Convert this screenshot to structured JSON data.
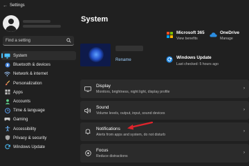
{
  "window": {
    "title": "Settings"
  },
  "search": {
    "placeholder": "Find a setting"
  },
  "sidebar": {
    "items": [
      {
        "label": "System",
        "icon": "monitor-icon",
        "color": "#4cc2ff",
        "active": true
      },
      {
        "label": "Bluetooth & devices",
        "icon": "bluetooth-icon",
        "color": "#4c9bff"
      },
      {
        "label": "Network & internet",
        "icon": "wifi-icon",
        "color": "#9ec9ff"
      },
      {
        "label": "Personalization",
        "icon": "brush-icon",
        "color": "#f0b35a"
      },
      {
        "label": "Apps",
        "icon": "apps-icon",
        "color": "#c9c9c9"
      },
      {
        "label": "Accounts",
        "icon": "person-icon",
        "color": "#5fd18b"
      },
      {
        "label": "Time & language",
        "icon": "globe-clock-icon",
        "color": "#5fa8ff"
      },
      {
        "label": "Gaming",
        "icon": "gamepad-icon",
        "color": "#c9c9c9"
      },
      {
        "label": "Accessibility",
        "icon": "accessibility-icon",
        "color": "#6fb8ff"
      },
      {
        "label": "Privacy & security",
        "icon": "shield-icon",
        "color": "#a7a7a7"
      },
      {
        "label": "Windows Update",
        "icon": "update-icon",
        "color": "#4cc2ff"
      }
    ]
  },
  "main": {
    "title": "System",
    "device": {
      "rename_label": "Rename"
    },
    "quick": [
      {
        "title": "Microsoft 365",
        "subtitle": "View benefits",
        "icon": "microsoft-icon"
      },
      {
        "title": "OneDrive",
        "subtitle": "Manage",
        "icon": "cloud-icon"
      },
      {
        "title": "Windows Update",
        "subtitle": "Last checked: 5 hours ago",
        "icon": "update-icon"
      }
    ],
    "cards": [
      {
        "title": "Display",
        "subtitle": "Monitors, brightness, night light, display profile",
        "icon": "display-icon"
      },
      {
        "title": "Sound",
        "subtitle": "Volume levels, output, input, sound devices",
        "icon": "speaker-icon"
      },
      {
        "title": "Notifications",
        "subtitle": "Alerts from apps and system, do not disturb",
        "icon": "bell-icon"
      },
      {
        "title": "Focus",
        "subtitle": "Reduce distractions",
        "icon": "focus-icon"
      }
    ]
  },
  "colors": {
    "accent": "#4cc2ff",
    "annotation_arrow": "#e0242c",
    "background": "#202020",
    "card": "#2b2b2b"
  }
}
